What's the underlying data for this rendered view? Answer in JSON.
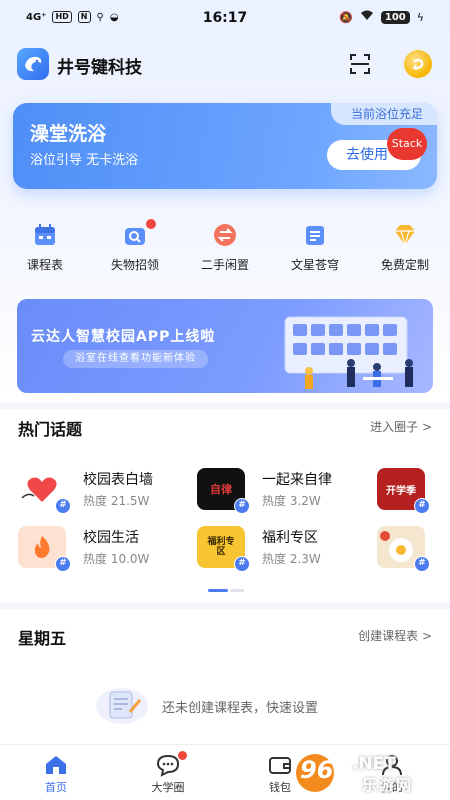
{
  "status_bar": {
    "network": "4G⁺",
    "chips": [
      "HD",
      "N"
    ],
    "time": "16:17",
    "battery": "100"
  },
  "header": {
    "app_name": "井号键科技",
    "icons": [
      "app-logo-icon",
      "scan-icon",
      "coin-icon"
    ]
  },
  "bath_card": {
    "title": "澡堂洗浴",
    "subtitle": "浴位引导 无卡洗浴",
    "status": "当前浴位充足",
    "button": "去使用",
    "badge": "Stack"
  },
  "quick_nav": [
    {
      "label": "课程表",
      "icon": "calendar-icon"
    },
    {
      "label": "失物招领",
      "icon": "lost-found-icon",
      "dot": true
    },
    {
      "label": "二手闲置",
      "icon": "exchange-icon"
    },
    {
      "label": "文星苍穹",
      "icon": "document-icon"
    },
    {
      "label": "免费定制",
      "icon": "diamond-icon"
    }
  ],
  "banner": {
    "title": "云达人智慧校园APP上线啦",
    "subtitle": "浴室在线查看功能新体验"
  },
  "hot_topics": {
    "title": "热门话题",
    "link": "进入圈子 >",
    "items": [
      {
        "name": "校园表白墙",
        "heat": "热度 21.5W"
      },
      {
        "name": "一起来自律",
        "heat": "热度 3.2W"
      },
      {
        "name": "校园生活",
        "heat": "热度 10.0W"
      },
      {
        "name": "福利专区",
        "heat": "热度 2.3W"
      }
    ],
    "thumb_text": {
      "zilu": "自律",
      "kaixueji": "开学季",
      "fuli": "福利专区"
    }
  },
  "schedule": {
    "title": "星期五",
    "link": "创建课程表 >",
    "empty_text": "还未创建课程表，快速设置"
  },
  "tab_bar": [
    {
      "label": "首页",
      "active": true
    },
    {
      "label": "大学圈",
      "dot": true
    },
    {
      "label": "钱包"
    },
    {
      "label": "我的"
    }
  ],
  "watermark": {
    "number": "962",
    "suffix": ".NET",
    "text": "乐游网"
  },
  "colors": {
    "accent": "#4a7cf0",
    "card_gradient_start": "#4f8ef7",
    "badge_red": "#e8382f"
  }
}
